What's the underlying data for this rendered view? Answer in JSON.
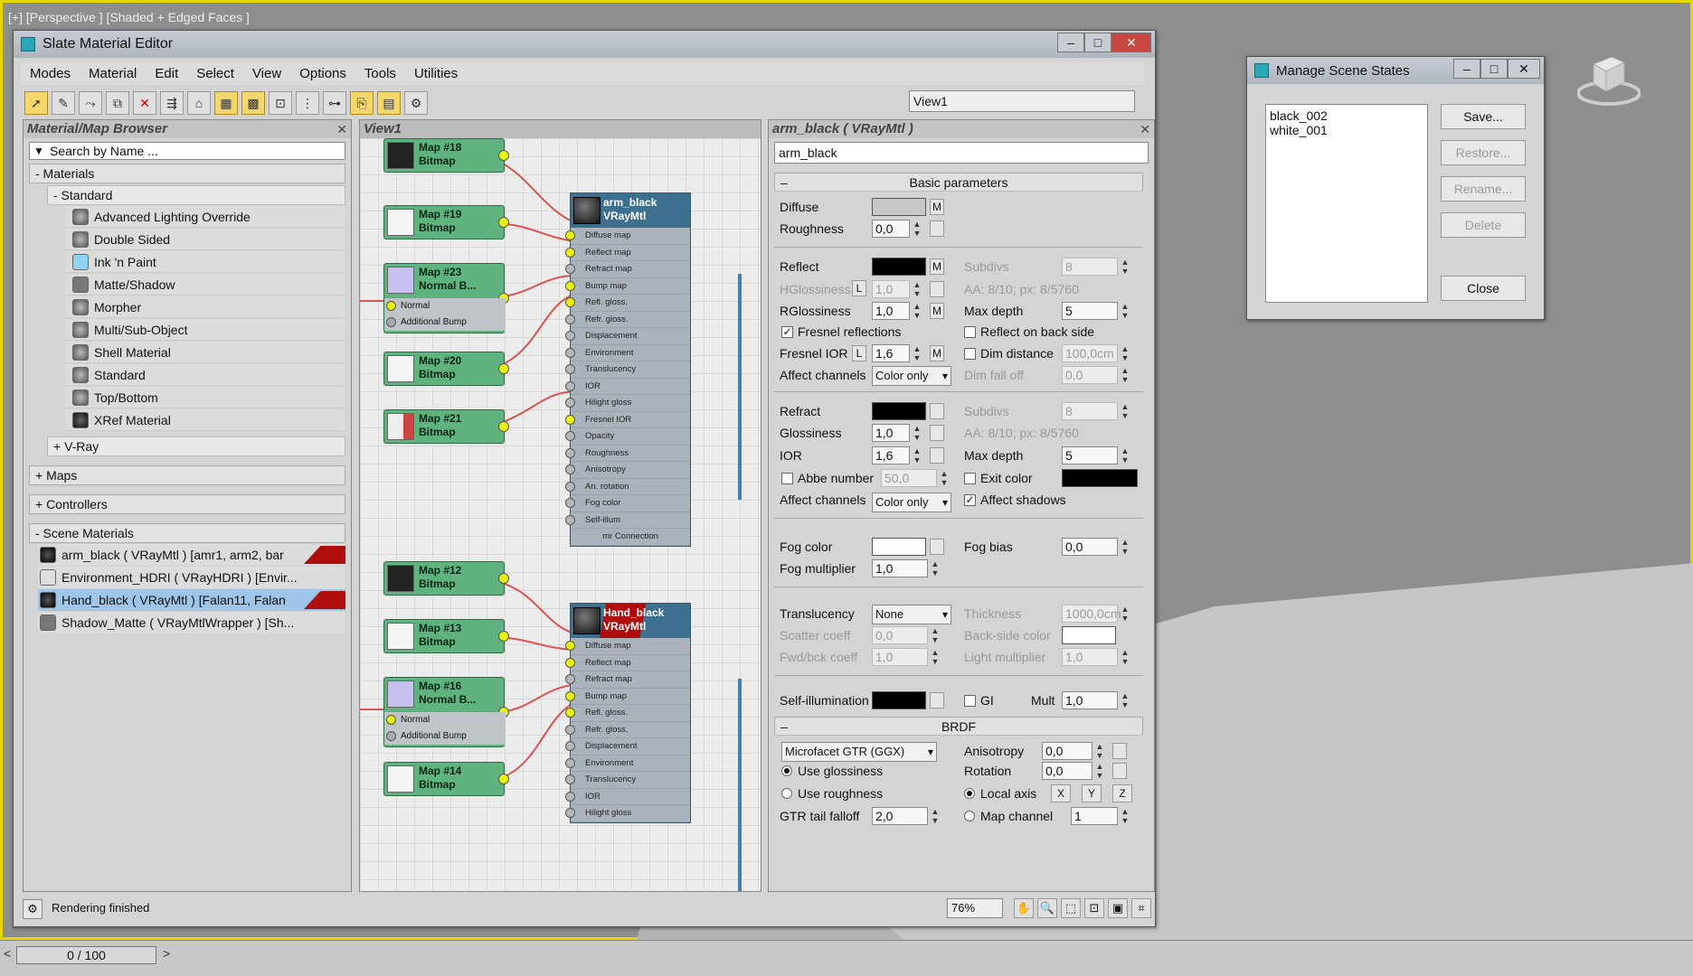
{
  "viewport": {
    "label": "[+] [Perspective ] [Shaded + Edged Faces ]"
  },
  "timeslider": {
    "value": "0 / 100",
    "prev": "<",
    "next": ">"
  },
  "slate": {
    "title": "Slate Material Editor",
    "menu": [
      "Modes",
      "Material",
      "Edit",
      "Select",
      "View",
      "Options",
      "Tools",
      "Utilities"
    ],
    "view_select": "View1",
    "browser": {
      "title": "Material/Map Browser",
      "search_placeholder": "Search by Name ...",
      "materials_label": "- Materials",
      "standard_label": "- Standard",
      "standard_items": [
        "Advanced Lighting Override",
        "Double Sided",
        "Ink 'n Paint",
        "Matte/Shadow",
        "Morpher",
        "Multi/Sub-Object",
        "Shell Material",
        "Standard",
        "Top/Bottom",
        "XRef Material"
      ],
      "vray_label": "+ V-Ray",
      "maps_label": "+ Maps",
      "controllers_label": "+ Controllers",
      "scene_materials_label": "- Scene Materials",
      "scene_items": [
        "arm_black  ( VRayMtl )  [amr1, arm2, bar",
        "Environment_HDRI  ( VRayHDRI )  [Envir...",
        "Hand_black  ( VRayMtl ) [Falan11, Falan",
        "Shadow_Matte  ( VRayMtlWrapper )  [Sh..."
      ]
    },
    "view1": {
      "title": "View1",
      "map_nodes": [
        {
          "name": "Map #18",
          "type": "Bitmap"
        },
        {
          "name": "Map #19",
          "type": "Bitmap"
        },
        {
          "name": "Map #23",
          "type": "Normal B..."
        },
        {
          "name": "Map #20",
          "type": "Bitmap"
        },
        {
          "name": "Map #21",
          "type": "Bitmap"
        },
        {
          "name": "Map #12",
          "type": "Bitmap"
        },
        {
          "name": "Map #13",
          "type": "Bitmap"
        },
        {
          "name": "Map #16",
          "type": "Normal B..."
        },
        {
          "name": "Map #14",
          "type": "Bitmap"
        }
      ],
      "normal_slots": [
        "Normal",
        "Additional Bump"
      ],
      "material_nodes": [
        {
          "name": "arm_black",
          "type": "VRayMtl"
        },
        {
          "name": "Hand_black",
          "type": "VRayMtl"
        }
      ],
      "slots": [
        "Diffuse map",
        "Reflect map",
        "Refract map",
        "Bump map",
        "Refl. gloss.",
        "Refr. gloss.",
        "Displacement",
        "Environment",
        "Translucency",
        "IOR",
        "Hilight gloss",
        "Fresnel IOR",
        "Opacity",
        "Roughness",
        "Anisotropy",
        "An. rotation",
        "Fog color",
        "Self-illum"
      ],
      "footer": "mr Connection"
    },
    "params": {
      "title": "arm_black  ( VRayMtl )",
      "name_value": "arm_black",
      "basic_title": "Basic parameters",
      "diffuse": "Diffuse",
      "roughness": "Roughness",
      "roughness_val": "0,0",
      "reflect": "Reflect",
      "subdivs": "Subdivs",
      "subdivs_val": "8",
      "hgloss": "HGlossiness",
      "hgloss_val": "1,0",
      "aa_text": "AA: 8/10; px: 8/5760",
      "rgloss": "RGlossiness",
      "rgloss_val": "1,0",
      "maxdepth": "Max depth",
      "maxdepth_val": "5",
      "fresnel": "Fresnel reflections",
      "reflect_back": "Reflect on back side",
      "fresnel_ior": "Fresnel IOR",
      "fresnel_ior_val": "1,6",
      "dim_distance": "Dim distance",
      "dim_distance_val": "100,0cm",
      "affect_channels": "Affect channels",
      "color_only": "Color only",
      "dim_falloff": "Dim fall off",
      "dim_falloff_val": "0,0",
      "refract": "Refract",
      "glossiness": "Glossiness",
      "glossiness_val": "1,0",
      "ior": "IOR",
      "ior_val": "1,6",
      "abbe": "Abbe number",
      "abbe_val": "50,0",
      "exit_color": "Exit color",
      "affect_shadows": "Affect shadows",
      "fog_color": "Fog color",
      "fog_bias": "Fog bias",
      "fog_bias_val": "0,0",
      "fog_mult": "Fog multiplier",
      "fog_mult_val": "1,0",
      "translucency": "Translucency",
      "translucency_val": "None",
      "thickness": "Thickness",
      "thickness_val": "1000,0cm",
      "scatter": "Scatter coeff",
      "scatter_val": "0,0",
      "backside": "Back-side color",
      "fwdbck": "Fwd/bck coeff",
      "fwdbck_val": "1,0",
      "light_mult": "Light multiplier",
      "light_mult_val": "1,0",
      "self_illum": "Self-illumination",
      "gi": "GI",
      "mult": "Mult",
      "mult_val": "1,0",
      "brdf_title": "BRDF",
      "brdf_type": "Microfacet GTR (GGX)",
      "anisotropy": "Anisotropy",
      "anisotropy_val": "0,0",
      "rotation": "Rotation",
      "rotation_val": "0,0",
      "use_gloss": "Use glossiness",
      "use_rough": "Use roughness",
      "local_axis": "Local axis",
      "map_channel": "Map channel",
      "map_channel_val": "1",
      "gtr": "GTR tail falloff",
      "gtr_val": "2,0",
      "m": "M",
      "l": "L",
      "x": "X",
      "y": "Y",
      "z": "Z"
    },
    "status": "Rendering finished",
    "zoom": "76%"
  },
  "mss": {
    "title": "Manage Scene States",
    "states": [
      "black_002",
      "white_001"
    ],
    "save": "Save...",
    "restore": "Restore...",
    "rename": "Rename...",
    "delete": "Delete",
    "close": "Close"
  },
  "colors": {
    "viewport_border": "#e6d600",
    "map_node": "#5fb37f",
    "wire": "#d9534f",
    "mat_head": "#3d6f8f"
  }
}
